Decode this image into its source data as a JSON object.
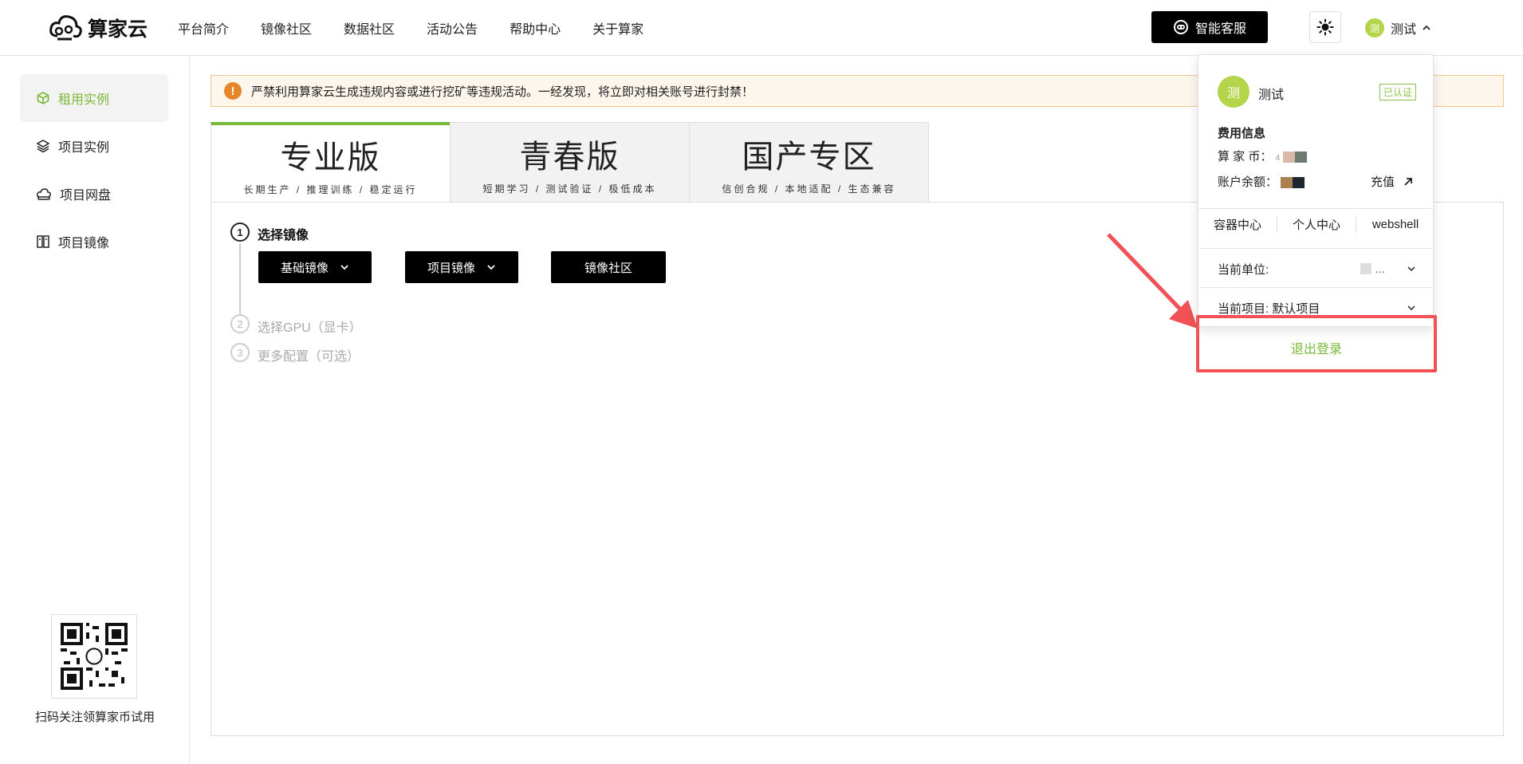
{
  "brand": {
    "name": "算家云"
  },
  "nav": [
    "平台简介",
    "镜像社区",
    "数据社区",
    "活动公告",
    "帮助中心",
    "关于算家"
  ],
  "header": {
    "service_label": "智能客服",
    "user_name": "测试",
    "avatar_char": "测"
  },
  "sidebar": {
    "items": [
      {
        "label": "租用实例",
        "icon": "cube-icon",
        "active": true
      },
      {
        "label": "项目实例",
        "icon": "layers-icon",
        "active": false
      },
      {
        "label": "项目网盘",
        "icon": "cloud-disk-icon",
        "active": false
      },
      {
        "label": "项目镜像",
        "icon": "image-icon",
        "active": false
      }
    ],
    "qr_caption": "扫码关注领算家币试用"
  },
  "notice": {
    "text": "严禁利用算家云生成违规内容或进行挖矿等违规活动。一经发现，将立即对相关账号进行封禁！"
  },
  "tabs": [
    {
      "title": "专业版",
      "sub": "长期生产 / 推理训练 / 稳定运行",
      "active": true
    },
    {
      "title": "青春版",
      "sub": "短期学习 / 测试验证 / 极低成本",
      "active": false
    },
    {
      "title": "国产专区",
      "sub": "信创合规 / 本地适配 / 生态兼容",
      "active": false
    }
  ],
  "steps": [
    {
      "num": "1",
      "label": "选择镜像"
    },
    {
      "num": "2",
      "label": "选择GPU（显卡）"
    },
    {
      "num": "3",
      "label": "更多配置（可选）"
    }
  ],
  "image_buttons": {
    "base": "基础镜像",
    "project": "项目镜像",
    "community": "镜像社区"
  },
  "dropdown": {
    "avatar_char": "测",
    "name": "测试",
    "badge": "已认证",
    "fee_title": "费用信息",
    "coin_label": "算 家 币：",
    "coin_prefix": "4",
    "balance_label": "账户余额：",
    "recharge_label": "充值",
    "links": [
      "容器中心",
      "个人中心",
      "webshell"
    ],
    "unit_label": "当前单位:",
    "unit_value": "...",
    "project_label": "当前项目: 默认项目",
    "logout_label": "退出登录"
  },
  "colors": {
    "accent": "#7ab83a",
    "highlight": "#f05255",
    "notice_icon": "#e6862b"
  }
}
